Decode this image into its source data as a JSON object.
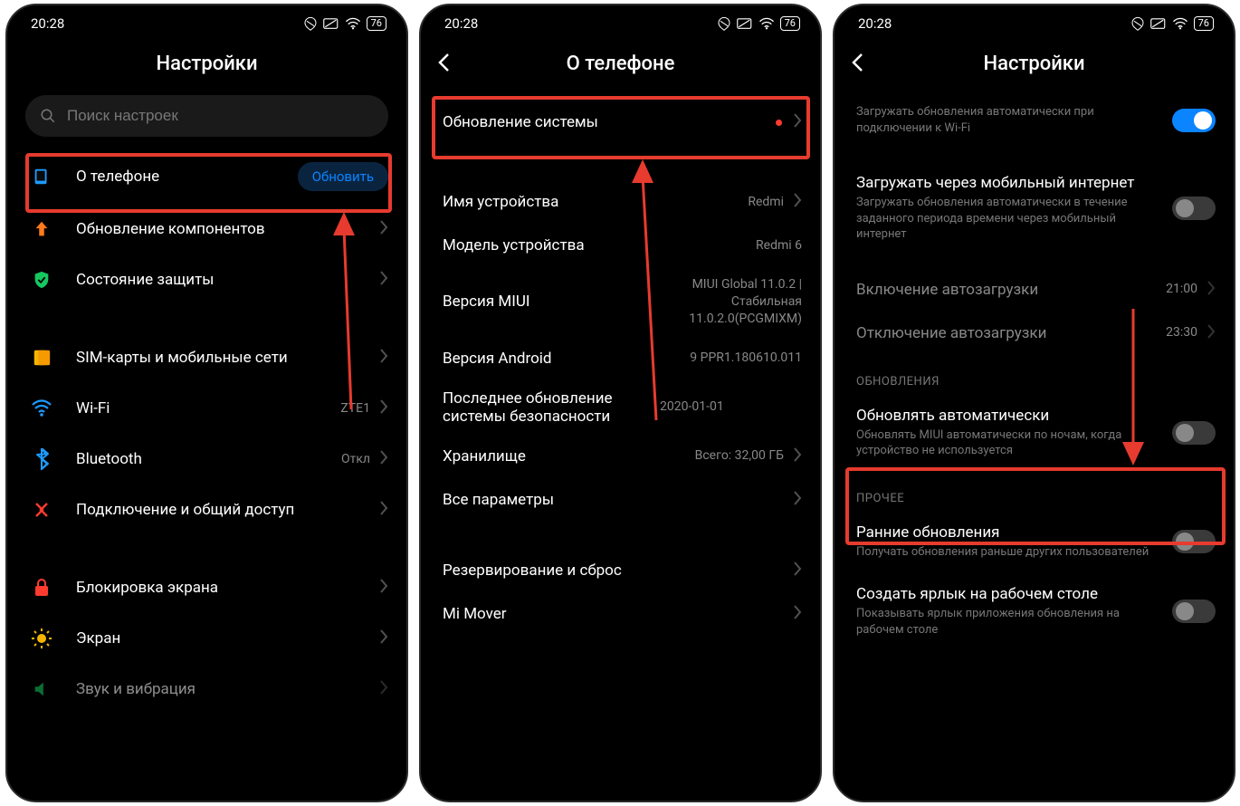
{
  "status": {
    "time": "20:28",
    "battery": "76"
  },
  "screen1": {
    "title": "Настройки",
    "search_placeholder": "Поиск настроек",
    "about": {
      "label": "О телефоне",
      "pill": "Обновить"
    },
    "items": [
      {
        "icon": "arrow-up-orange-icon",
        "label": "Обновление компонентов"
      },
      {
        "icon": "shield-green-icon",
        "label": "Состояние защиты"
      }
    ],
    "group2": [
      {
        "icon": "sim-yellow-icon",
        "label": "SIM-карты и мобильные сети"
      },
      {
        "icon": "wifi-blue-icon",
        "label": "Wi-Fi",
        "value": "ZTE1"
      },
      {
        "icon": "bluetooth-blue-icon",
        "label": "Bluetooth",
        "value": "Откл"
      },
      {
        "icon": "share-red-icon",
        "label": "Подключение и общий доступ"
      }
    ],
    "group3": [
      {
        "icon": "lock-red-icon",
        "label": "Блокировка экрана"
      },
      {
        "icon": "sun-yellow-icon",
        "label": "Экран"
      },
      {
        "icon": "sound-green-icon",
        "label": "Звук и вибрация"
      }
    ]
  },
  "screen2": {
    "title": "О телефоне",
    "update": {
      "label": "Обновление системы"
    },
    "info": [
      {
        "label": "Имя устройства",
        "value": "Redmi",
        "chevron": true
      },
      {
        "label": "Модель устройства",
        "value": "Redmi 6"
      },
      {
        "label": "Версия MIUI",
        "value": "MIUI Global 11.0.2 | Стабильная 11.0.2.0(PCGMIXM)"
      },
      {
        "label": "Версия Android",
        "value": "9 PPR1.180610.011"
      },
      {
        "label": "Последнее обновление системы безопасности",
        "value": "2020-01-01"
      },
      {
        "label": "Хранилище",
        "value": "Всего: 32,00 ГБ",
        "chevron": true
      },
      {
        "label": "Все параметры",
        "value": "",
        "chevron": true
      }
    ],
    "group2": [
      {
        "label": "Резервирование и сброс",
        "chevron": true
      },
      {
        "label": "Mi Mover",
        "chevron": true
      }
    ]
  },
  "screen3": {
    "title": "Настройки",
    "top": {
      "label": "Загружать обновления автоматически при подключении к Wi-Fi",
      "on": true
    },
    "mobile": {
      "label": "Загружать через мобильный интернет",
      "sub": "Загружать обновления автоматически в течение заданного периода времени через мобильный интернет",
      "on": false
    },
    "times": [
      {
        "label": "Включение автозагрузки",
        "value": "21:00"
      },
      {
        "label": "Отключение автозагрузки",
        "value": "23:30"
      }
    ],
    "section_updates": "ОБНОВЛЕНИЯ",
    "auto": {
      "label": "Обновлять автоматически",
      "sub": "Обновлять MIUI автоматически по ночам, когда устройство не используется",
      "on": false
    },
    "section_other": "ПРОЧЕЕ",
    "other": [
      {
        "label": "Ранние обновления",
        "sub": "Получать обновления раньше других пользователей",
        "on": false
      },
      {
        "label": "Создать ярлык на рабочем столе",
        "sub": "Показывать ярлык приложения обновления на рабочем столе",
        "on": false
      }
    ]
  }
}
